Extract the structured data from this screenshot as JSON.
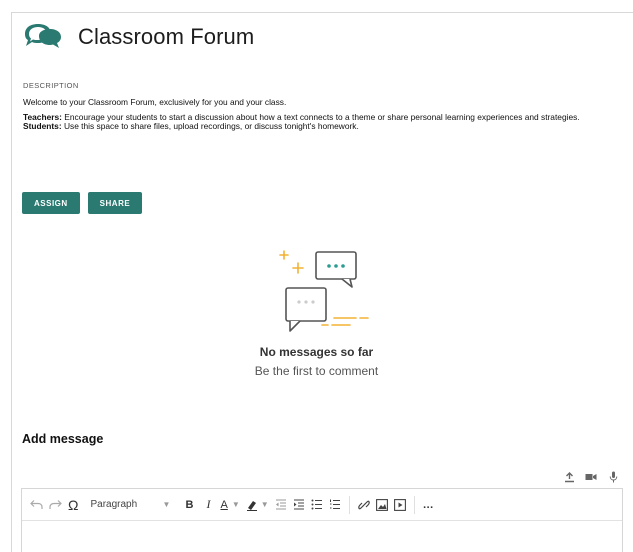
{
  "header": {
    "title": "Classroom Forum",
    "logo_icon": "chat-bubbles-icon",
    "accent_color": "#2b7a72"
  },
  "description": {
    "label": "DESCRIPTION",
    "welcome": "Welcome to your Classroom Forum, exclusively for you and your class.",
    "teachers_label": "Teachers:",
    "teachers_text": " Encourage your students to start a discussion about how a text connects to a theme or share personal learning experiences and strategies.",
    "students_label": "Students:",
    "students_text": " Use this space to share files, upload recordings, or discuss tonight's homework."
  },
  "actions": {
    "assign_label": "ASSIGN",
    "share_label": "SHARE"
  },
  "empty_state": {
    "title": "No messages so far",
    "subtitle": "Be the first to comment"
  },
  "composer": {
    "heading": "Add message",
    "paragraph_select": "Paragraph",
    "more_label": "…"
  }
}
